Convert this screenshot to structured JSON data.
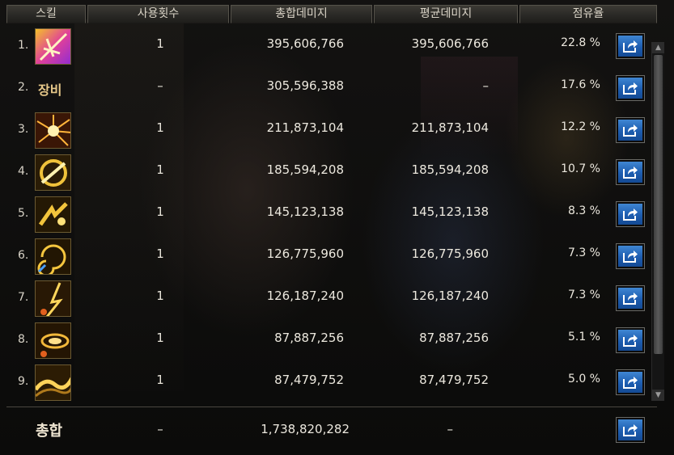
{
  "header": {
    "skill": "스킬",
    "uses": "사용횟수",
    "total_damage": "총합데미지",
    "avg_damage": "평균데미지",
    "share": "점유율"
  },
  "rows": [
    {
      "rank": "1.",
      "icon": "skill-icon-purple-slash",
      "uses": "1",
      "total": "395,606,766",
      "avg": "395,606,766",
      "share": "22.8 %"
    },
    {
      "rank": "2.",
      "label": "장비",
      "uses": "–",
      "total": "305,596,388",
      "avg": "–",
      "share": "17.6 %"
    },
    {
      "rank": "3.",
      "icon": "skill-icon-burst",
      "uses": "1",
      "total": "211,873,104",
      "avg": "211,873,104",
      "share": "12.2 %"
    },
    {
      "rank": "4.",
      "icon": "skill-icon-ring-slash",
      "uses": "1",
      "total": "185,594,208",
      "avg": "185,594,208",
      "share": "10.7 %"
    },
    {
      "rank": "5.",
      "icon": "skill-icon-dash",
      "uses": "1",
      "total": "145,123,138",
      "avg": "145,123,138",
      "share": "8.3 %"
    },
    {
      "rank": "6.",
      "icon": "skill-icon-swirl",
      "uses": "1",
      "total": "126,775,960",
      "avg": "126,775,960",
      "share": "7.3 %"
    },
    {
      "rank": "7.",
      "icon": "skill-icon-strike",
      "uses": "1",
      "total": "126,187,240",
      "avg": "126,187,240",
      "share": "7.3 %"
    },
    {
      "rank": "8.",
      "icon": "skill-icon-vortex",
      "uses": "1",
      "total": "87,887,256",
      "avg": "87,887,256",
      "share": "5.1 %"
    },
    {
      "rank": "9.",
      "icon": "skill-icon-wave",
      "uses": "1",
      "total": "87,479,752",
      "avg": "87,479,752",
      "share": "5.0 %"
    }
  ],
  "summary": {
    "label": "총합",
    "uses": "–",
    "total": "1,738,820,282",
    "avg": "–"
  },
  "colors": {
    "accent_button": "#2a6bc0",
    "header_text": "#d9d3c6",
    "icon_border": "#6b5a32"
  },
  "icons": {
    "share": "share-export-icon"
  }
}
